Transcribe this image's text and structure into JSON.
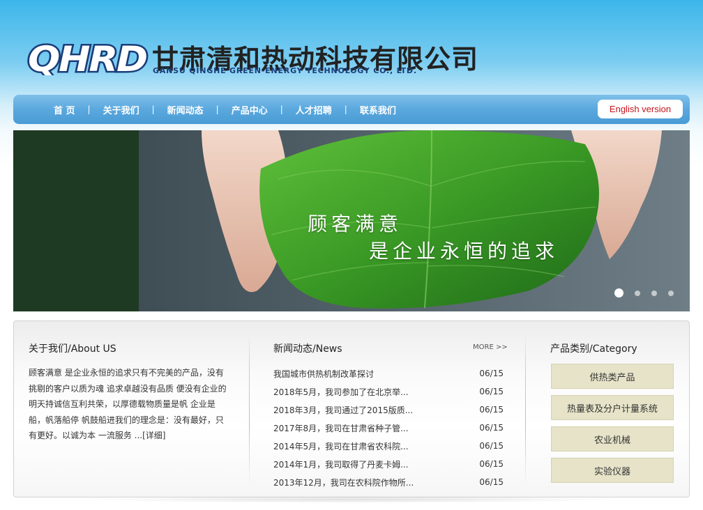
{
  "header": {
    "logo_mark_text": "QHRD",
    "company_cn": "甘肃清和热动科技有限公司",
    "company_en": "GANSU QINGHE GREEN-ENERGY TECHNOLOGY CO., LTD."
  },
  "nav": {
    "items": [
      {
        "label": "首 页"
      },
      {
        "label": "关于我们"
      },
      {
        "label": "新闻动态"
      },
      {
        "label": "产品中心"
      },
      {
        "label": "人才招聘"
      },
      {
        "label": "联系我们"
      }
    ],
    "separator": "|",
    "english_version": "English version"
  },
  "banner": {
    "slogan_line1": "顾客满意",
    "slogan_line2": "是企业永恒的追求",
    "slide_count": 4,
    "active_slide": 1
  },
  "about": {
    "title": "关于我们/About US",
    "text": "顾客满意 是企业永恒的追求只有不完美的产品，没有挑剔的客户以质为魂 追求卓越没有品质 便没有企业的明天持诚信互利共荣，以厚德载物质量是帆 企业是船，帆落船停 帆鼓船进我们的理念是：没有最好，只有更好。以诚为本 一流服务 ",
    "detail_link": "...[详细]"
  },
  "news": {
    "title": "新闻动态/News",
    "more": "MORE >>",
    "items": [
      {
        "title": "我国城市供热机制改革探讨",
        "date": "06/15"
      },
      {
        "title": "2018年5月，我司参加了在北京举...",
        "date": "06/15"
      },
      {
        "title": "2018年3月，我司通过了2015版质...",
        "date": "06/15"
      },
      {
        "title": "2017年8月，我司在甘肃省种子管...",
        "date": "06/15"
      },
      {
        "title": "2014年5月，我司在甘肃省农科院...",
        "date": "06/15"
      },
      {
        "title": "2014年1月，我司取得了丹麦卡姆...",
        "date": "06/15"
      },
      {
        "title": "2013年12月，我司在农科院作物所...",
        "date": "06/15"
      }
    ]
  },
  "category": {
    "title": "产品类别/Category",
    "items": [
      {
        "label": "供热类产品"
      },
      {
        "label": "热量表及分户计量系统"
      },
      {
        "label": "农业机械"
      },
      {
        "label": "实验仪器"
      }
    ]
  },
  "colors": {
    "brand_blue": "#1a3d7a",
    "nav_blue": "#5aa8de",
    "english_red": "#c8141c",
    "category_bg": "#e6e3c8"
  }
}
